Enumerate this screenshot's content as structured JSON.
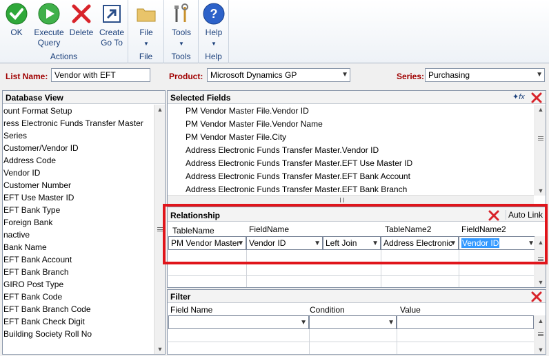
{
  "ribbon": {
    "actions": {
      "label": "Actions",
      "ok": "OK",
      "execute_line1": "Execute",
      "execute_line2": "Query",
      "delete": "Delete",
      "create_line1": "Create",
      "create_line2": "Go To"
    },
    "file": {
      "button": "File",
      "label": "File"
    },
    "tools": {
      "button": "Tools",
      "label": "Tools"
    },
    "help": {
      "button": "Help",
      "label": "Help"
    }
  },
  "header": {
    "list_name_label": "List Name:",
    "list_name_value": "Vendor with EFT",
    "product_label": "Product:",
    "product_value": "Microsoft Dynamics GP",
    "series_label": "Series:",
    "series_value": "Purchasing"
  },
  "database_view": {
    "title": "Database View",
    "items": [
      "ount Format Setup",
      "ress Electronic Funds Transfer Master",
      "Series",
      "Customer/Vendor ID",
      "Address Code",
      "Vendor ID",
      "Customer Number",
      "EFT Use Master ID",
      "EFT Bank Type",
      "Foreign Bank",
      "nactive",
      "Bank Name",
      "EFT Bank Account",
      "EFT Bank Branch",
      "GIRO Post Type",
      "EFT Bank Code",
      "EFT Bank Branch Code",
      "EFT Bank Check Digit",
      "Building Society Roll No"
    ]
  },
  "selected_fields": {
    "title": "Selected Fields",
    "items": [
      "PM Vendor Master File.Vendor ID",
      "PM Vendor Master File.Vendor Name",
      "PM Vendor Master File.City",
      "Address Electronic Funds Transfer Master.Vendor ID",
      "Address Electronic Funds Transfer Master.EFT Use Master ID",
      "Address Electronic Funds Transfer Master.EFT Bank Account",
      "Address Electronic Funds Transfer Master.EFT Bank Branch"
    ]
  },
  "relationship": {
    "title": "Relationship",
    "auto_link": "Auto Link",
    "columns": [
      "TableName",
      "FieldName",
      "TableName2",
      "FieldName2"
    ],
    "row": {
      "table_name": "PM Vendor Master",
      "field_name": "Vendor ID",
      "join": "Left Join",
      "table_name2": "Address Electronic",
      "field_name2": "Vendor ID"
    }
  },
  "filter": {
    "title": "Filter",
    "columns": [
      "Field Name",
      "Condition",
      "Value"
    ]
  },
  "colors": {
    "highlight_border": "#e0151b",
    "selected_cell": "#3399ff",
    "label_red": "#a00000"
  }
}
